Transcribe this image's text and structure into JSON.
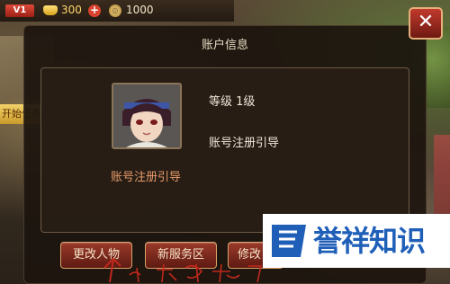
{
  "status": {
    "vip": "V1",
    "gold": "300",
    "gold_add": "+",
    "coins": "1000"
  },
  "background": {
    "side_banner": "开始任务"
  },
  "dialog": {
    "title": "账户信息",
    "level": "等级 1级",
    "subtext": "账号注册引导",
    "avatar_name": "账号注册引导",
    "buttons": {
      "change_character": "更改人物",
      "new_server": "新服务区",
      "modify": "修改"
    },
    "close_label": "✕"
  },
  "watermark": {
    "text": "誉祥知识"
  },
  "icons": {
    "gold": "gold-ingot-icon",
    "coin": "coin-icon",
    "close": "close-icon"
  },
  "colors": {
    "dialog_bg": "#1c140e",
    "button": "#7a2a1c",
    "button_border": "#d9a36a",
    "avatar_name": "#e89a6a",
    "watermark_blue": "#1f5fb8",
    "annotation_red": "#c0281c"
  }
}
